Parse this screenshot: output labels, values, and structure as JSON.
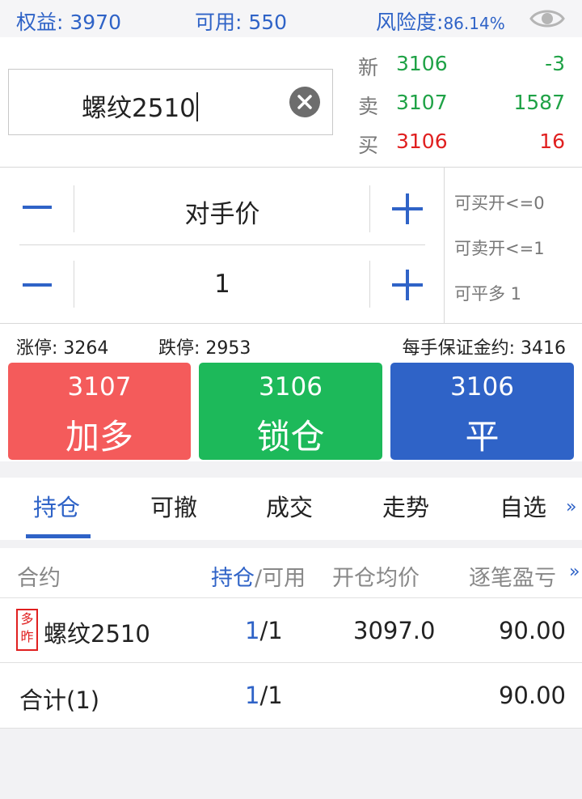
{
  "account": {
    "equity_label": "权益: ",
    "equity_value": "3970",
    "available_label": "可用: ",
    "available_value": "550",
    "risk_label": "风险度:",
    "risk_value": "86.14%"
  },
  "instrument": {
    "name": "螺纹2510"
  },
  "quotes": [
    {
      "label": "新",
      "price": "3106",
      "qty": "-3"
    },
    {
      "label": "卖",
      "price": "3107",
      "qty": "1587"
    },
    {
      "label": "买",
      "price": "3106",
      "qty": "16"
    }
  ],
  "order": {
    "price_mode": "对手价",
    "quantity": "1",
    "can_buy_open": "可买开<=0",
    "can_sell_open": "可卖开<=1",
    "can_close_long": "可平多 1"
  },
  "limits": {
    "limit_up": "涨停: 3264",
    "limit_down": "跌停: 2953",
    "margin_per_lot": "每手保证金约: 3416"
  },
  "buttons": [
    {
      "price": "3107",
      "label": "加多",
      "color": "#f45b5b"
    },
    {
      "price": "3106",
      "label": "锁仓",
      "color": "#1db95a"
    },
    {
      "price": "3106",
      "label": "平",
      "color": "#2f63c7"
    }
  ],
  "tabs": [
    "持仓",
    "可撤",
    "成交",
    "走势",
    "自选"
  ],
  "table": {
    "headers": {
      "contract": "合约",
      "position": "持仓",
      "available": "/可用",
      "avg_price": "开仓均价",
      "pnl": "逐笔盈亏"
    },
    "rows": [
      {
        "badge": "多昨",
        "contract": "螺纹2510",
        "pos": "1",
        "avail": "/1",
        "avg": "3097.0",
        "pnl": "90.00"
      }
    ],
    "total": {
      "label": "合计(1)",
      "pos": "1",
      "avail": "/1",
      "pnl": "90.00"
    }
  },
  "more_glyph": "»",
  "colors": {
    "accent": "#2f63c7",
    "up": "#e02020",
    "down": "#1fa246"
  }
}
